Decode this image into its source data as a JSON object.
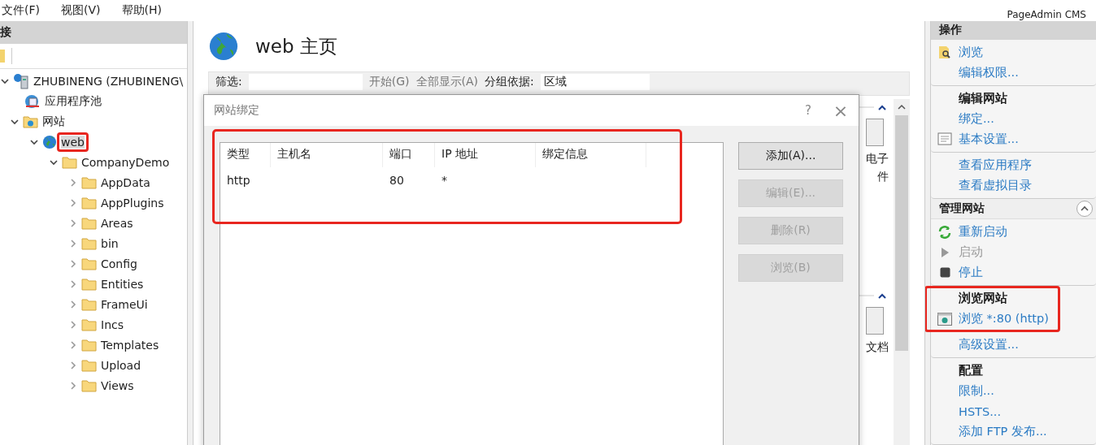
{
  "menu_bar": {
    "items": [
      "文件(F)",
      "视图(V)",
      "帮助(H)"
    ],
    "brand": "PageAdmin CMS"
  },
  "connections": {
    "title": "接",
    "tree": [
      {
        "label": "ZHUBINENG (ZHUBINENG\\",
        "expanded": true,
        "selected": false,
        "children": [
          {
            "label": "应用程序池",
            "selected": false
          },
          {
            "label": "网站",
            "expanded": true,
            "selected": false,
            "children": [
              {
                "label": "web",
                "expanded": true,
                "selected": true,
                "highlighted": true,
                "children": [
                  {
                    "label": "CompanyDemo",
                    "expanded": true,
                    "selected": false,
                    "children": [
                      {
                        "label": "AppData",
                        "expanded": false,
                        "selected": false
                      },
                      {
                        "label": "AppPlugins",
                        "expanded": false,
                        "selected": false
                      },
                      {
                        "label": "Areas",
                        "expanded": false,
                        "selected": false
                      },
                      {
                        "label": "bin",
                        "expanded": false,
                        "selected": false
                      },
                      {
                        "label": "Config",
                        "expanded": false,
                        "selected": false
                      },
                      {
                        "label": "Entities",
                        "expanded": false,
                        "selected": false
                      },
                      {
                        "label": "FrameUi",
                        "expanded": false,
                        "selected": false
                      },
                      {
                        "label": "Incs",
                        "expanded": false,
                        "selected": false
                      },
                      {
                        "label": "Templates",
                        "expanded": false,
                        "selected": false
                      },
                      {
                        "label": "Upload",
                        "expanded": false,
                        "selected": false
                      },
                      {
                        "label": "Views",
                        "expanded": false,
                        "selected": false
                      }
                    ]
                  }
                ]
              }
            ]
          }
        ]
      }
    ]
  },
  "main": {
    "title": "web 主页",
    "filter_bar": {
      "filter_label": "筛选:",
      "go_button": "开始(G)",
      "show_all_button": "全部显示(A)",
      "group_label": "分组依据:",
      "group_value": "区域"
    },
    "feature_fragments": [
      {
        "lines": [
          "电子",
          "件"
        ]
      },
      {
        "lines": [
          "文档"
        ]
      }
    ]
  },
  "dialog": {
    "title": "网站绑定",
    "help": "?",
    "close": "×",
    "highlighted": true,
    "columns": [
      "类型",
      "主机名",
      "端口",
      "IP 地址",
      "绑定信息"
    ],
    "rows": [
      {
        "cells": [
          "http",
          null,
          "80",
          "*",
          null
        ]
      }
    ],
    "buttons": [
      {
        "label": "添加(A)...",
        "disabled": false
      },
      {
        "label": "编辑(E)...",
        "disabled": true
      },
      {
        "label": "删除(R)",
        "disabled": true
      },
      {
        "label": "浏览(B)",
        "disabled": true
      }
    ]
  },
  "actions": {
    "title": "操作",
    "groups": [
      {
        "kind": "group",
        "items": [
          {
            "kind": "link",
            "label": "浏览",
            "disabled": false
          },
          {
            "kind": "link",
            "label": "编辑权限...",
            "disabled": false
          }
        ]
      },
      {
        "kind": "group",
        "items": [
          {
            "kind": "title",
            "label": "编辑网站"
          },
          {
            "kind": "link",
            "label": "绑定...",
            "disabled": false
          },
          {
            "kind": "link",
            "label": "基本设置...",
            "disabled": false
          }
        ]
      },
      {
        "kind": "group",
        "items": [
          {
            "kind": "link",
            "label": "查看应用程序",
            "disabled": false
          },
          {
            "kind": "link",
            "label": "查看虚拟目录",
            "disabled": false
          }
        ]
      },
      {
        "kind": "section",
        "title": "管理网站",
        "expanded": true
      },
      {
        "kind": "group",
        "items": [
          {
            "kind": "link",
            "label": "重新启动",
            "disabled": false
          },
          {
            "kind": "link",
            "label": "启动",
            "disabled": true
          },
          {
            "kind": "link",
            "label": "停止",
            "disabled": false
          }
        ]
      },
      {
        "kind": "group",
        "highlighted": true,
        "items": [
          {
            "kind": "title",
            "label": "浏览网站"
          },
          {
            "kind": "link",
            "label": "浏览 *:80 (http)",
            "disabled": false
          }
        ]
      },
      {
        "kind": "group",
        "items": [
          {
            "kind": "link",
            "label": "高级设置...",
            "disabled": false
          }
        ]
      },
      {
        "kind": "group",
        "items": [
          {
            "kind": "title",
            "label": "配置"
          },
          {
            "kind": "link",
            "label": "限制...",
            "disabled": false
          },
          {
            "kind": "link",
            "label": "HSTS...",
            "disabled": false
          },
          {
            "kind": "link",
            "label": "添加 FTP 发布...",
            "disabled": false
          }
        ]
      }
    ]
  }
}
